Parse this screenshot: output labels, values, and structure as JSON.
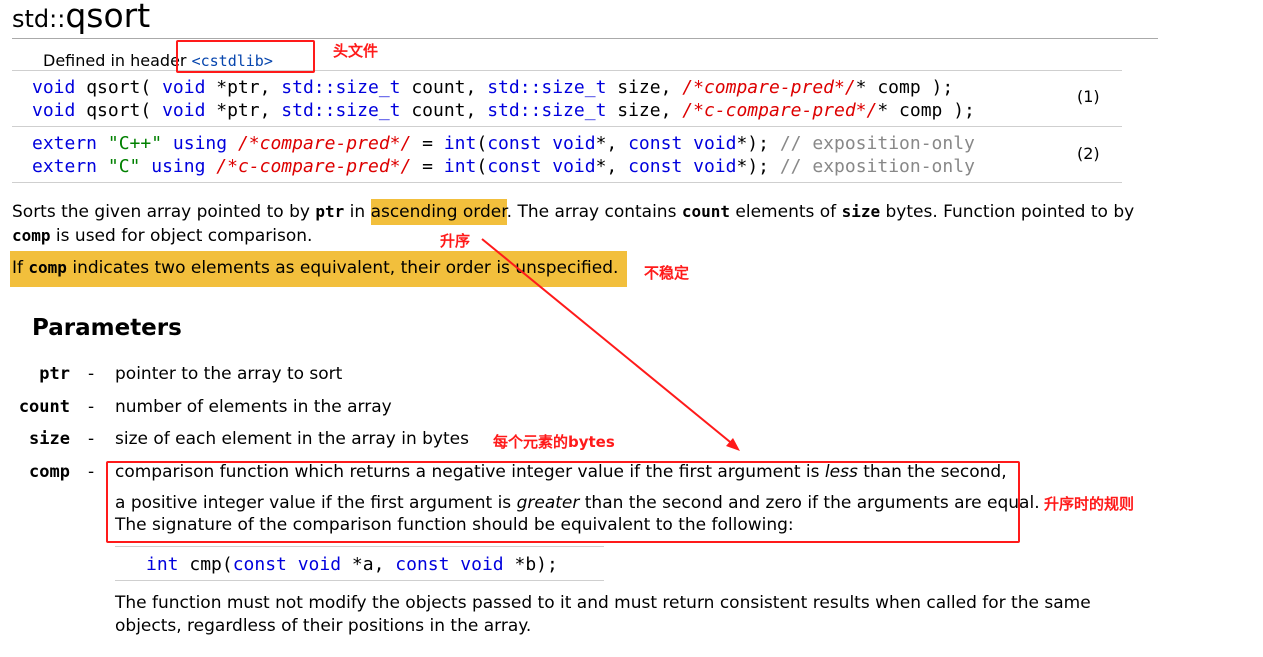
{
  "title": {
    "prefix": "std::",
    "name": "qsort"
  },
  "header": {
    "label": "Defined in header ",
    "link": "<cstdlib>"
  },
  "declarations": {
    "d1a": [
      "void",
      " qsort( ",
      "void",
      " *ptr, ",
      "std::size_t",
      " count, ",
      "std::size_t",
      " size, ",
      "/*compare-pred*/",
      "* comp );"
    ],
    "d1b": [
      "void",
      " qsort( ",
      "void",
      " *ptr, ",
      "std::size_t",
      " count, ",
      "std::size_t",
      " size, ",
      "/*c-compare-pred*/",
      "* comp );"
    ],
    "d2a": [
      "extern",
      " ",
      "\"C++\"",
      " ",
      "using",
      " ",
      "/*compare-pred*/",
      " = ",
      "int",
      "(",
      "const void",
      "*, ",
      "const void",
      "*); ",
      "// exposition-only"
    ],
    "d2b": [
      "extern",
      " ",
      "\"C\"",
      " ",
      "using",
      " ",
      "/*c-compare-pred*/",
      " = ",
      "int",
      "(",
      "const void",
      "*, ",
      "const void",
      "*); ",
      "// exposition-only"
    ],
    "num1": "(1)",
    "num2": "(2)"
  },
  "description": {
    "p1_a": "Sorts the given array pointed to by ",
    "p1_ptr": "ptr",
    "p1_b": " in ",
    "p1_hl": "ascending order",
    "p1_c": ". The array contains ",
    "p1_count": "count",
    "p1_d": " elements of ",
    "p1_size": "size",
    "p1_e": " bytes. Function pointed to by",
    "p1_comp": "comp",
    "p1_f": " is used for object comparison.",
    "p2_a": "If ",
    "p2_comp": "comp",
    "p2_b": " indicates two elements as equivalent, their order is unspecified."
  },
  "parameters": {
    "heading": "Parameters",
    "dash": "-",
    "items": [
      {
        "name": "ptr",
        "desc": "pointer to the array to sort"
      },
      {
        "name": "count",
        "desc": "number of elements in the array"
      },
      {
        "name": "size",
        "desc": "size of each element in the array in bytes"
      },
      {
        "name": "comp",
        "desc": "comparison function which returns a negative integer value if the first argument is "
      }
    ],
    "comp_less": "less",
    "comp_line1_end": " than the second,",
    "comp_line2_a": "a positive integer value if the first argument is ",
    "comp_greater": "greater",
    "comp_line2_b": " than the second and zero if the arguments are equal.",
    "comp_line3": "The signature of the comparison function should be equivalent to the following:",
    "sig": [
      "int",
      " cmp(",
      "const void",
      " *a, ",
      "const void",
      " *b);"
    ],
    "after1": "The function must not modify the objects passed to it and must return consistent results when called for the same",
    "after2": "objects, regardless of their positions in the array."
  },
  "annotations": {
    "header_file": "头文件",
    "ascending": "升序",
    "unstable": "不稳定",
    "bytes_each": "每个元素的bytes",
    "ascending_rule": "升序时的规则",
    "color": "#ff1a1a",
    "highlight_color": "#f2bf3c"
  }
}
